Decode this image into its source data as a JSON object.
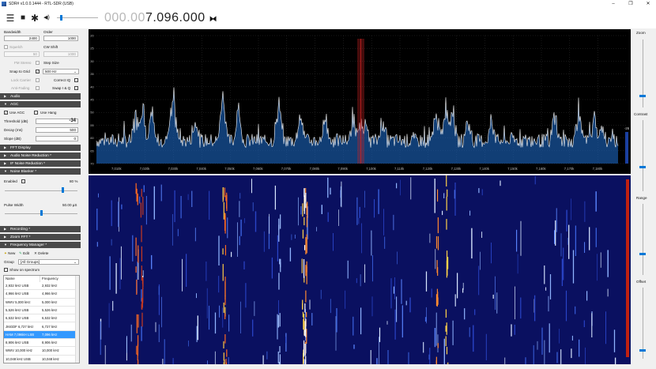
{
  "window": {
    "title": "SDR# v1.0.0.1444 - RTL-SDR (USB)",
    "minimize": "–",
    "maximize": "❐",
    "close": "✕"
  },
  "toolbar": {
    "menu_icon": "☰",
    "stop_icon": "■",
    "settings_icon": "✱",
    "volume_icon": "◀)",
    "freq_dim": "000.00",
    "freq_main": "7.096.000",
    "tune_icon": "⧓",
    "volume_level": 0.08
  },
  "radio": {
    "bandwidth_label": "Bandwidth",
    "order_label": "Order",
    "bandwidth_value": "2400",
    "order_value": "1000",
    "squelch_label": "Squelch",
    "cw_shift_label": "CW Shift",
    "squelch_value": "50",
    "cw_shift_value": "1000",
    "fm_stereo_label": "FM Stereo",
    "step_size_label": "Step Size",
    "snap_grid_label": "Snap to Grid",
    "snap_grid_value": "500 Hz",
    "lock_carrier_label": "Lock Carrier",
    "correct_iq_label": "Correct IQ",
    "anti_fading_label": "Anti-Fading",
    "swap_iq_label": "Swap I & Q"
  },
  "sections": {
    "audio": "Audio",
    "agc": "AGC",
    "fft_display": "FFT Display",
    "audio_noise_reduction": "Audio Noise Reduction *",
    "if_noise_reduction": "IF Noise Reduction *",
    "noise_blanker": "Noise Blanker *",
    "recording": "Recording *",
    "zoom_fft": "Zoom FFT *",
    "frequency_manager": "Frequency Manager *"
  },
  "agc": {
    "use_agc_label": "Use AGC",
    "use_hang_label": "Use Hang",
    "threshold_label": "Threshold (dB)",
    "threshold_value": "-34",
    "decay_label": "Decay (ms)",
    "decay_value": "500",
    "slope_label": "Slope (dB)",
    "slope_value": "0"
  },
  "noise_blanker": {
    "enabled_label": "Enabled",
    "enabled_value": "80 %",
    "pulse_width_label": "Pulse Width",
    "pulse_width_value": "50.00 µS",
    "enabled_level": 0.8,
    "pulse_width_level": 0.5
  },
  "freq_manager": {
    "new_label": "New",
    "edit_label": "Edit",
    "delete_label": "Delete",
    "group_label": "Group",
    "group_value": "[All Groups]",
    "show_on_spectrum_label": "Show on spectrum",
    "col_name": "Name",
    "col_frequency": "Frequency",
    "rows": [
      {
        "name": "2,932 kHz USB",
        "freq": "2,932 kHz"
      },
      {
        "name": "4,966 kHz USB",
        "freq": "4,966 kHz"
      },
      {
        "name": "WWV 5,000 kHz",
        "freq": "5,000 kHz"
      },
      {
        "name": "5,526 kHz USB",
        "freq": "5,526 kHz"
      },
      {
        "name": "6,532 kHz USB",
        "freq": "6,532 kHz"
      },
      {
        "name": "JI6GDF 6,727 kHz",
        "freq": "6,727 kHz"
      },
      {
        "name": "HAM 7,096kH LSB",
        "freq": "7,096 kHz"
      },
      {
        "name": "8,906 kHz USB",
        "freq": "8,906 kHz"
      },
      {
        "name": "WWV 10,000 kHz",
        "freq": "10,000 kHz"
      },
      {
        "name": "10,048 kHz USB",
        "freq": "10,048 kHz"
      }
    ],
    "selected_index": 6
  },
  "spectrum": {
    "y_ticks": [
      "-20",
      "-25",
      "-30",
      "-35",
      "-40",
      "-45",
      "-50",
      "-55",
      "-60",
      "-65",
      "-70"
    ],
    "x_ticks": [
      "7,010k",
      "7,020k",
      "7,030k",
      "7,040k",
      "7,050k",
      "7,060k",
      "7,070k",
      "7,080k",
      "7,090k",
      "7,100k",
      "7,110k",
      "7,120k",
      "7,130k",
      "7,140k",
      "7,150k",
      "7,160k",
      "7,170k",
      "7,180k"
    ],
    "right_value": "-26",
    "colors": {
      "background": "#000000",
      "trace": "#ffffff",
      "fill": "#1a5fb4",
      "marker": "#cc2222"
    }
  },
  "side_sliders": {
    "zoom_label": "Zoom",
    "contrast_label": "Contrast",
    "range_label": "Range",
    "offset_label": "Offset"
  }
}
